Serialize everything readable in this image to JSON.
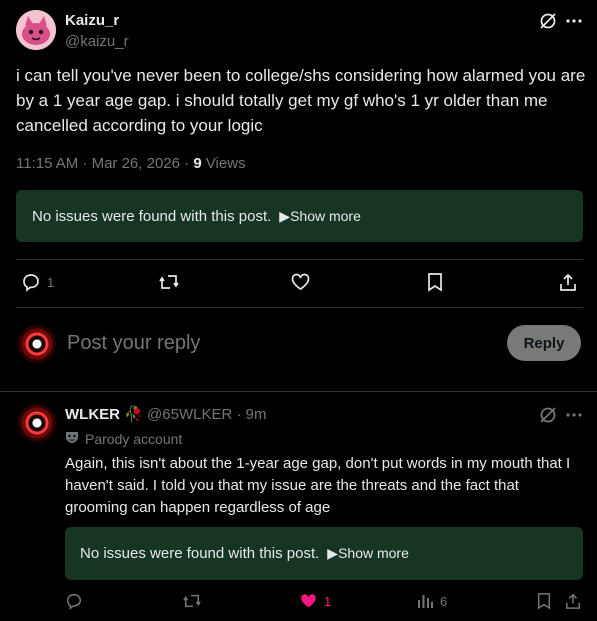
{
  "main_post": {
    "author_name": "Kaizu_r",
    "author_handle": "@kaizu_r",
    "text": "i can tell you've never been to college/shs considering how alarmed you are by a 1 year age gap. i should totally get my gf who's 1 yr older than me cancelled according to your logic",
    "timestamp": "11:15 AM · Mar 26, 2026 · ",
    "views_count": "9",
    "views_label": " Views",
    "note_text": "No issues were found with this post.",
    "show_more": "▶Show more",
    "replies_count": "1"
  },
  "composer": {
    "placeholder": "Post your reply",
    "reply_button": "Reply"
  },
  "reply_post": {
    "author_name": "WLKER",
    "author_emoji": "🥀",
    "author_handle": "@65WLKER · 9m",
    "parody_label": "Parody account",
    "text": "Again, this isn't about the 1-year age gap, don't put words in my mouth that I haven't said. I told you that my issue are the threats and the fact that grooming can happen regardless of age",
    "note_text": "No issues were found with this post.",
    "show_more": "▶Show more",
    "likes_count": "1",
    "views_count": "6"
  },
  "colors": {
    "background": "#000000",
    "text": "#e7e9ea",
    "muted": "#71767b",
    "note_bg": "#173523",
    "like_pink": "#f91880",
    "reply_button_bg": "#787a7a"
  },
  "icons": [
    "grok-icon",
    "more-icon",
    "reply-icon",
    "repost-icon",
    "like-icon",
    "bookmark-icon",
    "share-icon",
    "views-icon",
    "parody-mask-icon"
  ]
}
